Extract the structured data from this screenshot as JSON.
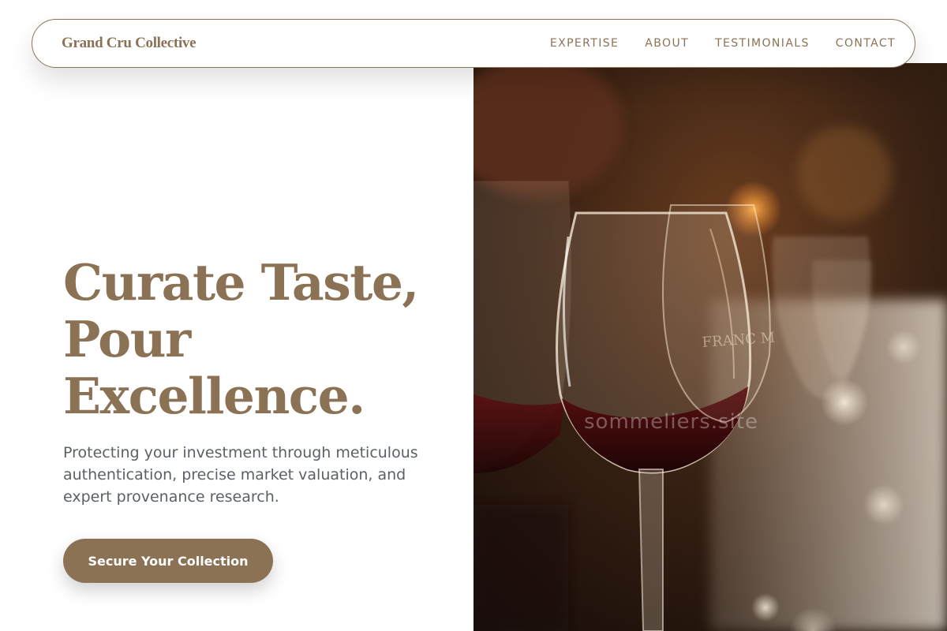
{
  "nav": {
    "brand": "Grand Cru Collective",
    "links": [
      "EXPERTISE",
      "ABOUT",
      "TESTIMONIALS",
      "CONTACT"
    ]
  },
  "hero": {
    "headline": [
      "Curate Taste,",
      "Pour",
      "Excellence."
    ],
    "subtext": "Protecting your investment through meticulous authentication, precise market valuation, and expert provenance research.",
    "cta_label": "Secure Your Collection",
    "image_watermark": "sommeliers.site"
  },
  "colors": {
    "accent": "#8c7255",
    "body_text": "#5b6068",
    "background": "#ffffff"
  }
}
